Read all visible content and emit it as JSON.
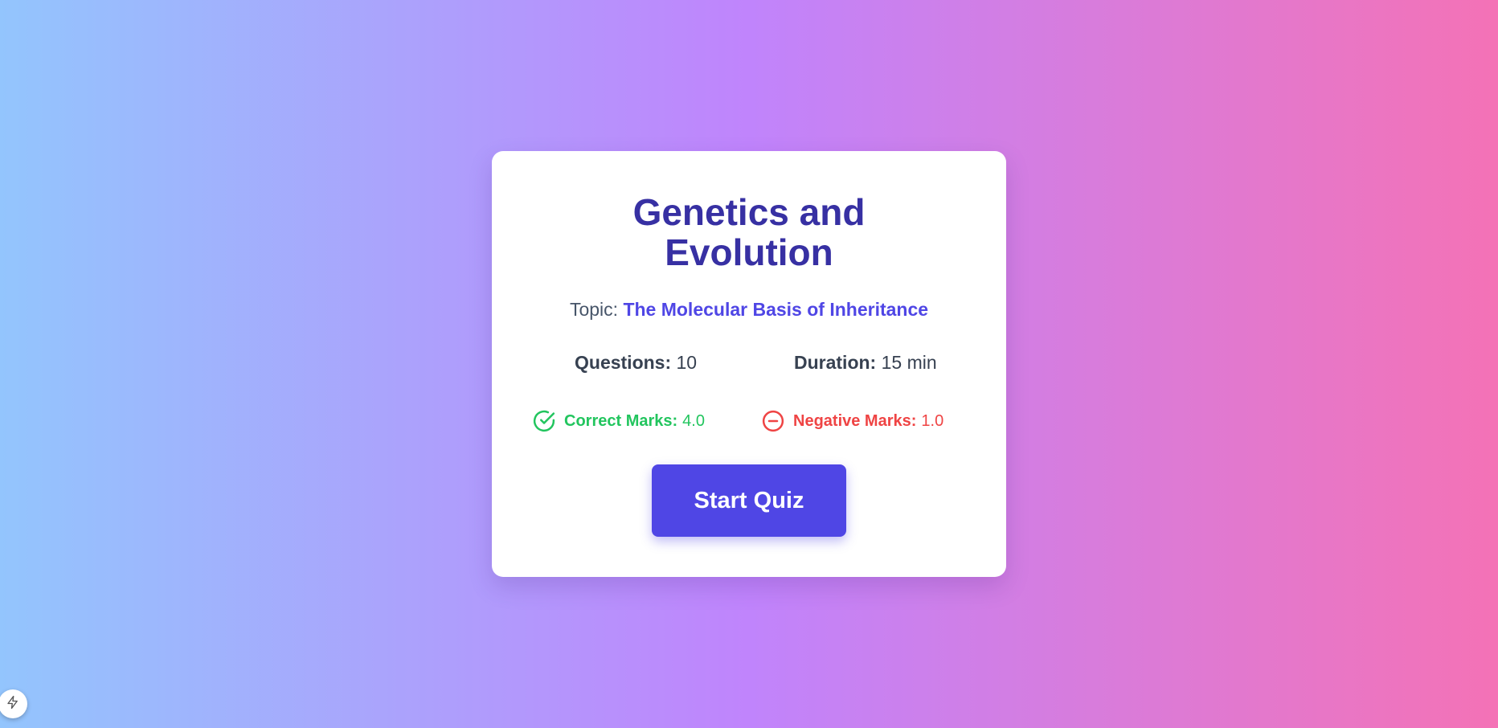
{
  "quiz": {
    "title": "Genetics and Evolution",
    "topic_label": "Topic:",
    "topic_name": "The Molecular Basis of Inheritance",
    "questions_label": "Questions:",
    "questions_value": "10",
    "duration_label": "Duration:",
    "duration_value": "15 min",
    "correct_marks_label": "Correct Marks:",
    "correct_marks_value": "4.0",
    "negative_marks_label": "Negative Marks:",
    "negative_marks_value": "1.0",
    "start_button_label": "Start Quiz"
  },
  "icons": {
    "correct": "check-circle-icon",
    "negative": "minus-circle-icon",
    "corner": "lightning-icon"
  },
  "colors": {
    "gradient_left": "#93c5fd",
    "gradient_mid": "#c084fc",
    "gradient_right": "#f472b6",
    "title": "#3730a3",
    "accent": "#4f46e5",
    "correct": "#22c55e",
    "negative": "#ef4444"
  }
}
